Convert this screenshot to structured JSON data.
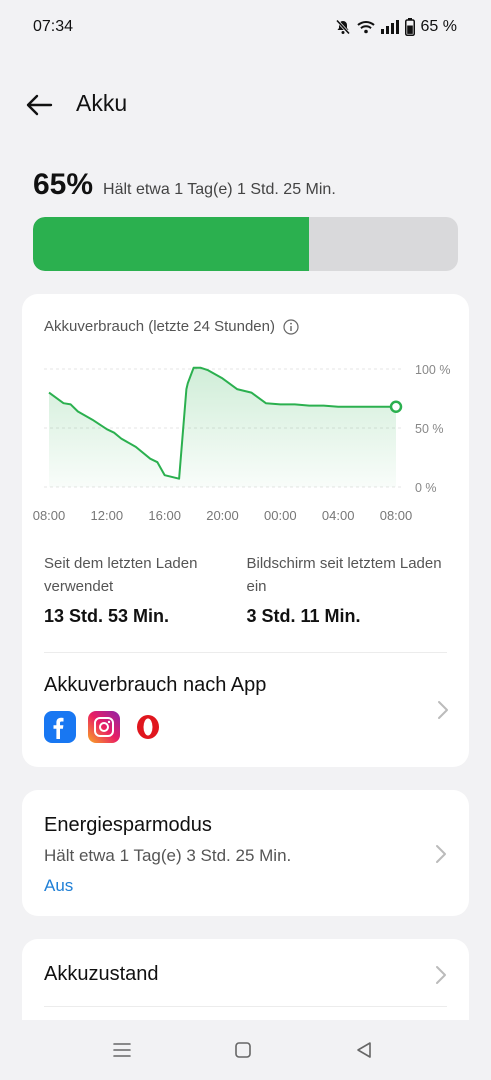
{
  "status_bar": {
    "time": "07:34",
    "battery_text": "65 %",
    "icons": [
      "mute-bell-icon",
      "wifi-icon",
      "signal-icon",
      "battery-icon"
    ]
  },
  "header": {
    "back_icon": "arrow-left-icon",
    "title": "Akku"
  },
  "battery": {
    "percent_label": "65%",
    "level": 0.65,
    "remaining": "Hält etwa 1 Tag(e) 1 Std. 25 Min.",
    "fill_color": "#2bb04f"
  },
  "usage_card": {
    "title": "Akkuverbrauch (letzte 24 Stunden)",
    "stats": [
      {
        "label": "Seit dem letzten Laden verwendet",
        "value": "13 Std. 53 Min."
      },
      {
        "label": "Bildschirm seit letztem Laden ein",
        "value": "3 Std. 11 Min."
      }
    ],
    "by_app": {
      "title": "Akkuverbrauch nach App",
      "apps": [
        "facebook-icon",
        "instagram-icon",
        "opera-icon"
      ]
    }
  },
  "chart_data": {
    "type": "area",
    "x_ticks": [
      "08:00",
      "12:00",
      "16:00",
      "20:00",
      "00:00",
      "04:00",
      "08:00"
    ],
    "y_ticks": [
      "100 %",
      "50 %",
      "0 %"
    ],
    "ylim": [
      0,
      100
    ],
    "series": [
      {
        "x": [
          0,
          1,
          1.5,
          2,
          3,
          4,
          4.5,
          5,
          6,
          7,
          7.5,
          8,
          9,
          9.5,
          9.6,
          10,
          10.5,
          11,
          12,
          13,
          14,
          15,
          16,
          17,
          18,
          19,
          20,
          21,
          22,
          23,
          24
        ],
        "values": [
          80,
          71,
          70,
          64,
          57,
          49,
          46,
          41,
          34,
          24,
          21,
          10,
          7,
          83,
          88,
          101,
          101,
          99,
          92,
          83,
          80,
          71,
          70,
          70,
          69,
          69,
          68,
          68,
          68,
          68,
          68
        ]
      }
    ],
    "grid": true,
    "line_color": "#2bb04f"
  },
  "energy_card": {
    "title": "Energiesparmodus",
    "subtitle": "Hält etwa 1 Tag(e) 3 Std. 25 Min.",
    "status": "Aus"
  },
  "health_card": {
    "title": "Akkuzustand"
  },
  "nav_bar": {
    "items": [
      "menu-icon",
      "home-icon",
      "back-icon"
    ]
  }
}
